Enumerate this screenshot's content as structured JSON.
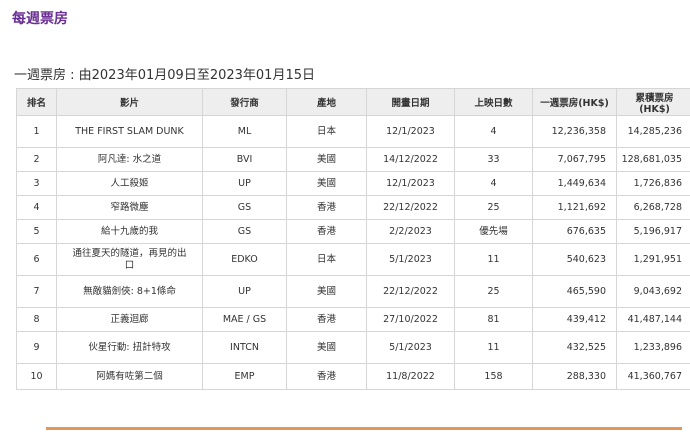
{
  "header": {
    "title": "每週票房",
    "period": "一週票房 : 由2023年01月09日至2023年01月15日"
  },
  "table": {
    "columns": [
      "排名",
      "影片",
      "發行商",
      "產地",
      "開畫日期",
      "上映日數",
      "一週票房(HK$)",
      "累積票房(HK$)"
    ],
    "rows": [
      {
        "rank": "1",
        "film": "THE FIRST SLAM DUNK",
        "distributor": "ML",
        "origin": "日本",
        "release": "12/1/2023",
        "days": "4",
        "weekly": "12,236,358",
        "cumulative": "14,285,236"
      },
      {
        "rank": "2",
        "film": "阿凡達: 水之道",
        "distributor": "BVI",
        "origin": "美國",
        "release": "14/12/2022",
        "days": "33",
        "weekly": "7,067,795",
        "cumulative": "128,681,035"
      },
      {
        "rank": "3",
        "film": "人工殺姬",
        "distributor": "UP",
        "origin": "美國",
        "release": "12/1/2023",
        "days": "4",
        "weekly": "1,449,634",
        "cumulative": "1,726,836"
      },
      {
        "rank": "4",
        "film": "窄路微塵",
        "distributor": "GS",
        "origin": "香港",
        "release": "22/12/2022",
        "days": "25",
        "weekly": "1,121,692",
        "cumulative": "6,268,728"
      },
      {
        "rank": "5",
        "film": "給十九歲的我",
        "distributor": "GS",
        "origin": "香港",
        "release": "2/2/2023",
        "days": "優先場",
        "weekly": "676,635",
        "cumulative": "5,196,917"
      },
      {
        "rank": "6",
        "film": "通往夏天的隧道，再見的出口",
        "distributor": "EDKO",
        "origin": "日本",
        "release": "5/1/2023",
        "days": "11",
        "weekly": "540,623",
        "cumulative": "1,291,951"
      },
      {
        "rank": "7",
        "film": "無敵貓劍俠: 8+1條命",
        "distributor": "UP",
        "origin": "美國",
        "release": "22/12/2022",
        "days": "25",
        "weekly": "465,590",
        "cumulative": "9,043,692"
      },
      {
        "rank": "8",
        "film": "正義迴廊",
        "distributor": "MAE / GS",
        "origin": "香港",
        "release": "27/10/2022",
        "days": "81",
        "weekly": "439,412",
        "cumulative": "41,487,144"
      },
      {
        "rank": "9",
        "film": "伙星行動: 扭計特攻",
        "distributor": "INTCN",
        "origin": "美國",
        "release": "5/1/2023",
        "days": "11",
        "weekly": "432,525",
        "cumulative": "1,233,896"
      },
      {
        "rank": "10",
        "film": "阿媽有咗第二個",
        "distributor": "EMP",
        "origin": "香港",
        "release": "11/8/2022",
        "days": "158",
        "weekly": "288,330",
        "cumulative": "41,360,767"
      }
    ]
  }
}
